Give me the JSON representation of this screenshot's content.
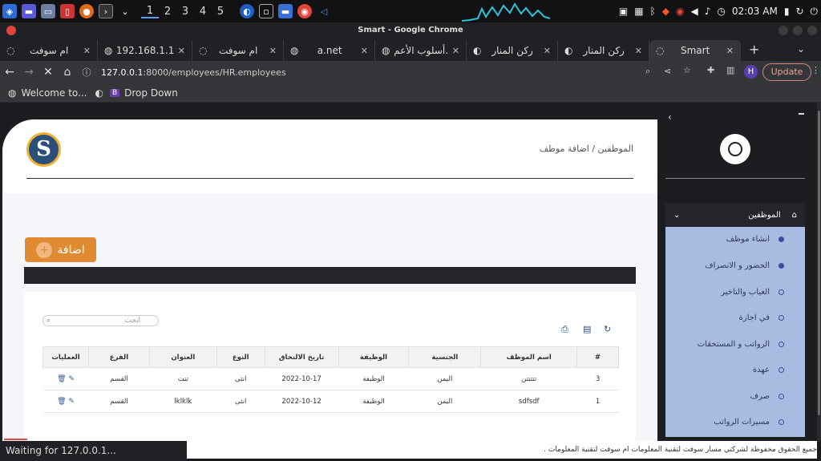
{
  "taskbar": {
    "workspaces": [
      "1",
      "2",
      "3",
      "4",
      "5"
    ],
    "clock": "02:03 AM"
  },
  "window": {
    "title": "Smart - Google Chrome"
  },
  "tabs": [
    {
      "label": "ام سوفت"
    },
    {
      "label": "192.168.1.1"
    },
    {
      "label": "ام سوفت"
    },
    {
      "label": "a.net"
    },
    {
      "label": "أسلوب الأعم."
    },
    {
      "label": "ركن المنار"
    },
    {
      "label": "ركن المنار"
    },
    {
      "label": "Smart"
    }
  ],
  "address": {
    "url_host": "127.0.0.1",
    "url_rest": ":8000/employees/HR.employees",
    "update_label": "Update",
    "profile": "H"
  },
  "bookmarks": [
    {
      "label": "Welcome to..."
    },
    {
      "label": "Drop Down"
    }
  ],
  "page": {
    "logo_letter": "S",
    "breadcrumb": "الموظفين / اضافة موظف",
    "add_label": "اضافة",
    "search_placeholder": "ابحث",
    "columns": [
      "#",
      "اسم الموظف",
      "الجنسية",
      "الوظيفة",
      "تاريخ الالتحاق",
      "النوع",
      "العنوان",
      "الفرع",
      "العمليات"
    ],
    "rows": [
      [
        "3",
        "تتتتتن",
        "اليمن",
        "الوظيفة",
        "2022-10-17",
        "انثى",
        "تتت",
        "القسم"
      ],
      [
        "1",
        "sdfsdf",
        "اليمن",
        "الوظيفة",
        "2022-10-12",
        "انثى",
        "lklklk",
        "القسم"
      ]
    ],
    "footer": "جميع الحقوق محفوظة لشركتي مسار سوفت لتقنية المعلومات ام سوفت لتقنية المعلومات ."
  },
  "sidebar": {
    "collapse_glyph": "‹",
    "menu_title": "الموظفين",
    "items": [
      {
        "label": "انشاء موظف",
        "filled": true
      },
      {
        "label": "الحضور و الانصراف",
        "filled": true
      },
      {
        "label": "الغياب والتاخير",
        "filled": false
      },
      {
        "label": "في اجازة",
        "filled": false
      },
      {
        "label": "الرواتب و المستحقات",
        "filled": false
      },
      {
        "label": "عهدة",
        "filled": false
      },
      {
        "label": "صرف",
        "filled": false
      },
      {
        "label": "مسيرات الرواتب",
        "filled": false
      }
    ]
  },
  "status": {
    "text": "Waiting for 127.0.0.1..."
  }
}
